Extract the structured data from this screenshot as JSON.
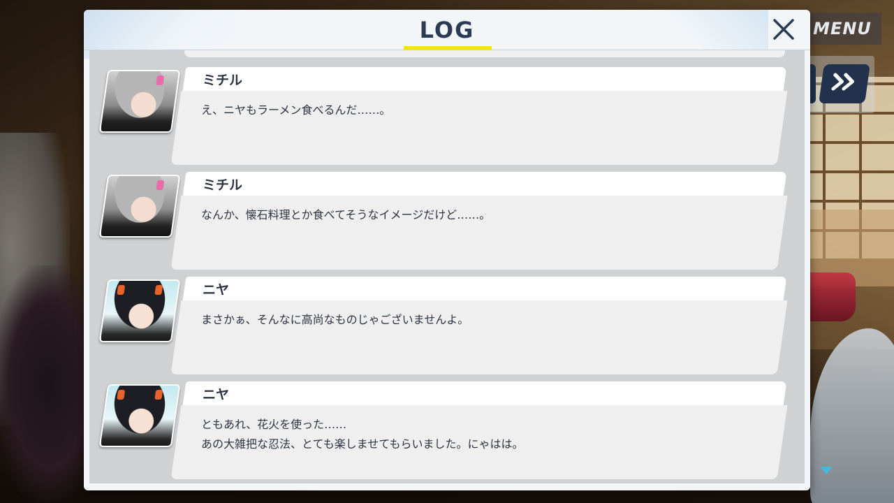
{
  "hud": {
    "menu_label": "MENU",
    "fast_forward_label": "»"
  },
  "dialog": {
    "title": "LOG",
    "close_label": "×"
  },
  "entries": [
    {
      "speaker": "ミチル",
      "avatar": "michiru",
      "text": "え、ニヤもラーメン食べるんだ……。"
    },
    {
      "speaker": "ミチル",
      "avatar": "michiru",
      "text": "なんか、懐石料理とか食べてそうなイメージだけど……。"
    },
    {
      "speaker": "ニヤ",
      "avatar": "niya",
      "text": "まさかぁ、そんなに高尚なものじゃございませんよ。"
    },
    {
      "speaker": "ニヤ",
      "avatar": "niya",
      "text": "ともあれ、花火を使った……\nあの大雑把な忍法、とても楽しませてもらいました。にゃはは。"
    }
  ],
  "colors": {
    "title_text": "#2b3b55",
    "title_underline": "#f7e11b",
    "scroll_indicator": "#48b6d8",
    "name_bar": "#ffffff",
    "message_box": "#efefef"
  }
}
